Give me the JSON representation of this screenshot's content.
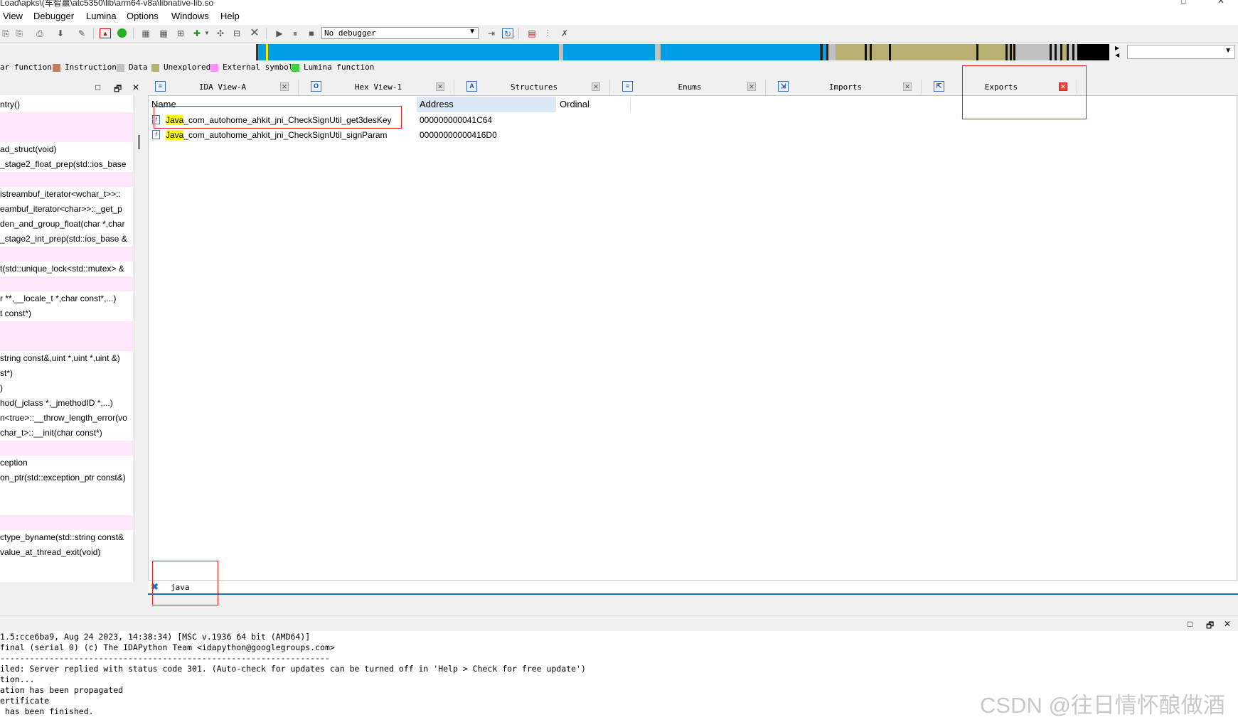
{
  "window": {
    "title": "Load\\apks\\(车智赢\\atc5350\\lib\\arm64-v8a\\libnative-lib.so",
    "controls": [
      "□",
      "✕"
    ]
  },
  "menu": [
    "View",
    "Debugger",
    "Lumina",
    "Options",
    "Windows",
    "Help"
  ],
  "toolbar": {
    "debugger_value": "No debugger"
  },
  "legend": [
    {
      "label": "ar function",
      "color": "#88c0f0"
    },
    {
      "label": "Instruction",
      "color": "#c08060"
    },
    {
      "label": "Data",
      "color": "#c0c0c0"
    },
    {
      "label": "Unexplored",
      "color": "#b8b070"
    },
    {
      "label": "External symbol",
      "color": "#ff90ff"
    },
    {
      "label": "Lumina function",
      "color": "#40d040"
    }
  ],
  "left_pane": {
    "controls": [
      "□",
      "🗗",
      "✕"
    ],
    "rows": [
      {
        "text": "ntry()",
        "pink": false
      },
      {
        "text": "",
        "pink": true
      },
      {
        "text": "",
        "pink": true
      },
      {
        "text": "ad_struct(void)",
        "pink": false
      },
      {
        "text": "_stage2_float_prep(std::ios_base",
        "pink": false
      },
      {
        "text": "",
        "pink": true
      },
      {
        "text": "istreambuf_iterator<wchar_t>>::",
        "pink": false
      },
      {
        "text": "eambuf_iterator<char>>::_get_p",
        "pink": false
      },
      {
        "text": "den_and_group_float(char *,char",
        "pink": false
      },
      {
        "text": "_stage2_int_prep(std::ios_base &",
        "pink": false
      },
      {
        "text": "",
        "pink": true
      },
      {
        "text": "t(std::unique_lock<std::mutex> &",
        "pink": false
      },
      {
        "text": "",
        "pink": true
      },
      {
        "text": "r **,__locale_t *,char const*,...)",
        "pink": false
      },
      {
        "text": "t const*)",
        "pink": false
      },
      {
        "text": "",
        "pink": true
      },
      {
        "text": "",
        "pink": true
      },
      {
        "text": "string const&,uint *,uint *,uint &)",
        "pink": false
      },
      {
        "text": "st*)",
        "pink": false
      },
      {
        "text": ")",
        "pink": false
      },
      {
        "text": "hod(_jclass *,_jmethodID *,...)",
        "pink": false
      },
      {
        "text": "n<true>::__throw_length_error(vo",
        "pink": false
      },
      {
        "text": "char_t>::__init(char const*)",
        "pink": false
      },
      {
        "text": "",
        "pink": true
      },
      {
        "text": "ception",
        "pink": false
      },
      {
        "text": "on_ptr(std::exception_ptr const&)",
        "pink": false
      },
      {
        "text": "",
        "pink": false
      },
      {
        "text": "",
        "pink": false
      },
      {
        "text": "",
        "pink": true
      },
      {
        "text": "ctype_byname(std::string const&",
        "pink": false
      },
      {
        "text": "value_at_thread_exit(void)",
        "pink": false
      }
    ]
  },
  "tabs": [
    {
      "label": "IDA View-A",
      "icon": "≡"
    },
    {
      "label": "Hex View-1",
      "icon": "O"
    },
    {
      "label": "Structures",
      "icon": "A"
    },
    {
      "label": "Enums",
      "icon": "≡"
    },
    {
      "label": "Imports",
      "icon": "⇲"
    },
    {
      "label": "Exports",
      "icon": "⇱",
      "active": true
    }
  ],
  "exports": {
    "columns": [
      "Name",
      "Address",
      "Ordinal"
    ],
    "rows": [
      {
        "name_hl": "Java",
        "name_rest": "_com_autohome_ahkit_jni_CheckSignUtil_get3desKey",
        "address": "000000000041C64",
        "ordinal": ""
      },
      {
        "name_hl": "Java",
        "name_rest": "_com_autohome_ahkit_jni_CheckSignUtil_signParam",
        "address": "00000000000416D0",
        "ordinal": ""
      }
    ],
    "filter": "java"
  },
  "output": {
    "controls": [
      "□",
      "🗗",
      "✕"
    ],
    "lines": [
      "1.5:cce6ba9, Aug 24 2023, 14:38:34) [MSC v.1936 64 bit (AMD64)]",
      "final (serial 0) (c) The IDAPython Team <idapython@googlegroups.com>",
      "-------------------------------------------------------------------",
      "iled: Server replied with status code 301. (Auto-check for updates can be turned off in 'Help > Check for free update')",
      "tion...",
      "ation has been propagated",
      "ertificate",
      " has been finished."
    ]
  },
  "watermark": "CSDN @往日情怀酿做酒",
  "colors": {
    "accent": "#1e6fbf",
    "highlight": "#ffff00",
    "annotation": "#e02020",
    "nav_blue": "#009fe3",
    "nav_olive": "#b8b070"
  }
}
